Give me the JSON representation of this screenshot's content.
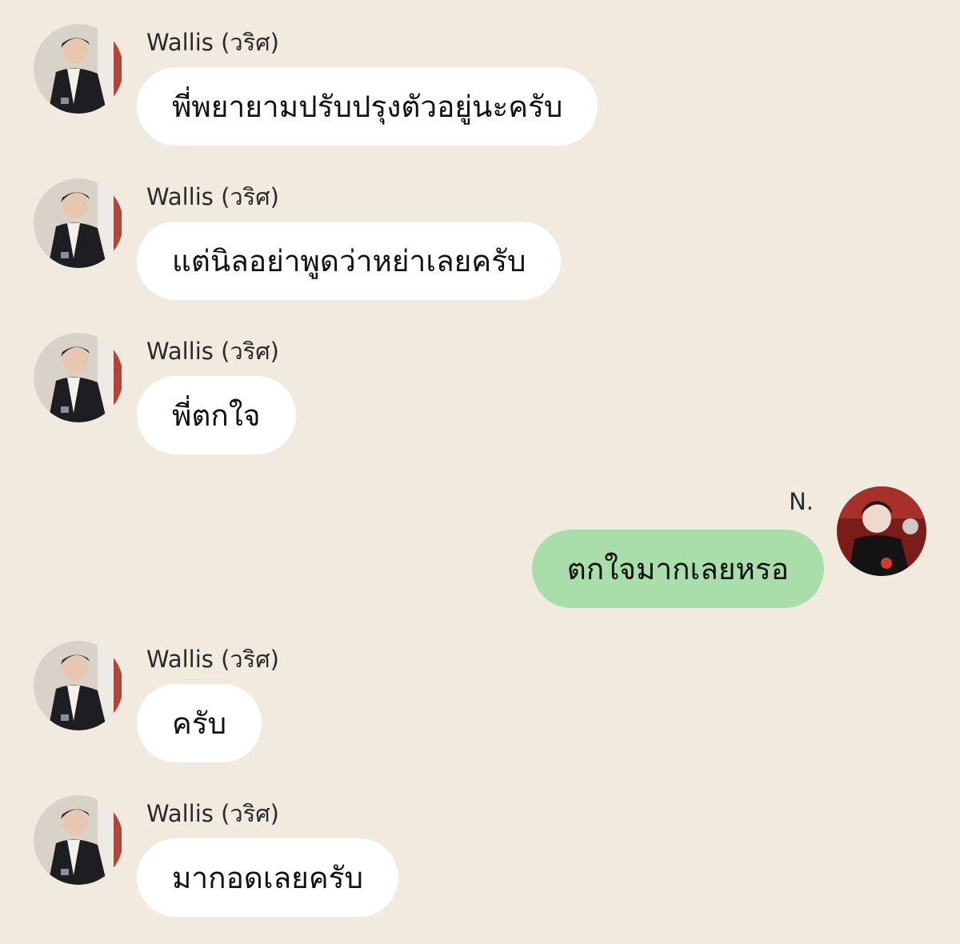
{
  "chat": {
    "messages": [
      {
        "sender": "Wallis (วริศ)",
        "text": "พี่พยายามปรับปรุงตัวอยู่นะครับ",
        "direction": "incoming"
      },
      {
        "sender": "Wallis (วริศ)",
        "text": "แต่นิลอย่าพูดว่าหย่าเลยครับ",
        "direction": "incoming"
      },
      {
        "sender": "Wallis (วริศ)",
        "text": "พี่ตกใจ",
        "direction": "incoming"
      },
      {
        "sender": "N.",
        "text": "ตกใจมากเลยหรอ",
        "direction": "outgoing"
      },
      {
        "sender": "Wallis (วริศ)",
        "text": "ครับ",
        "direction": "incoming"
      },
      {
        "sender": "Wallis (วริศ)",
        "text": "มากอดเลยครับ",
        "direction": "incoming"
      }
    ]
  },
  "colors": {
    "background": "#f1ebdf",
    "incoming_bubble": "#ffffff",
    "outgoing_bubble": "#a9deaa"
  },
  "icons": {
    "wallis_avatar": "avatar-photo-man-in-dark-suit",
    "n_avatar": "avatar-photo-person-red-background"
  }
}
